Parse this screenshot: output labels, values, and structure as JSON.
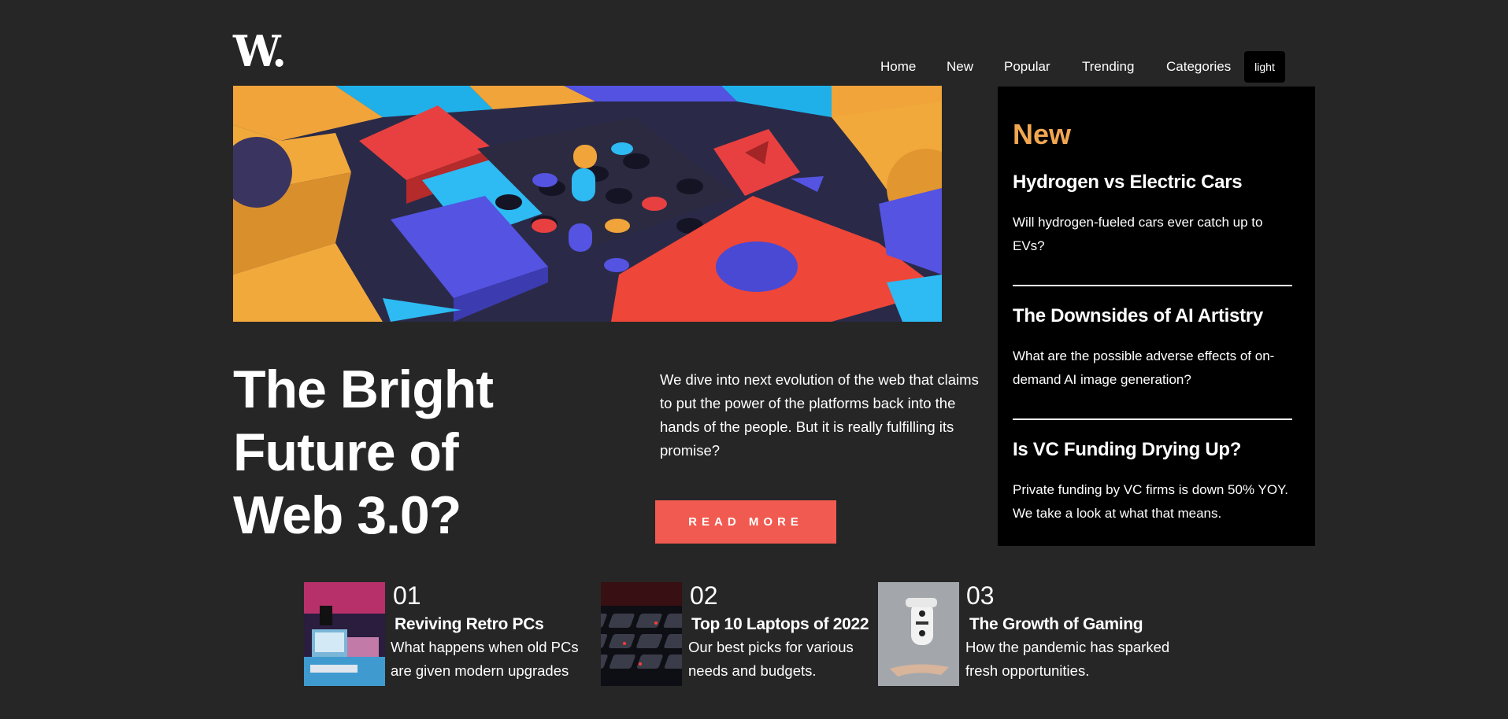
{
  "brand": {
    "logo": "W."
  },
  "nav": {
    "items": [
      "Home",
      "New",
      "Popular",
      "Trending",
      "Categories"
    ],
    "theme_toggle": "light"
  },
  "hero": {
    "title": "The Bright Future of Web 3.0?",
    "description": "We dive into next evolution of the web that claims to put the power of the platforms back into the hands of the people. But it is really fulfilling its promise?",
    "cta": "READ MORE"
  },
  "sidebar": {
    "heading": "New",
    "items": [
      {
        "title": "Hydrogen vs Electric Cars",
        "description": "Will hydrogen-fueled cars ever catch up to EVs?"
      },
      {
        "title": "The Downsides of AI Artistry",
        "description": "What are the possible adverse effects of on-demand AI image generation?"
      },
      {
        "title": "Is VC Funding Drying Up?",
        "description": "Private funding by VC firms is down 50% YOY. We take a look at what that means."
      }
    ]
  },
  "cards": [
    {
      "number": "01",
      "title": "Reviving Retro PCs",
      "description": "What happens when old PCs are given modern upgrades"
    },
    {
      "number": "02",
      "title": "Top 10 Laptops of 2022",
      "description": "Our best picks for various needs and budgets."
    },
    {
      "number": "03",
      "title": "The Growth of Gaming",
      "description": "How the pandemic has sparked fresh opportunities."
    }
  ],
  "colors": {
    "background": "#262626",
    "accent": "#f1a752",
    "cta": "#f15a50",
    "panel": "#000000"
  }
}
